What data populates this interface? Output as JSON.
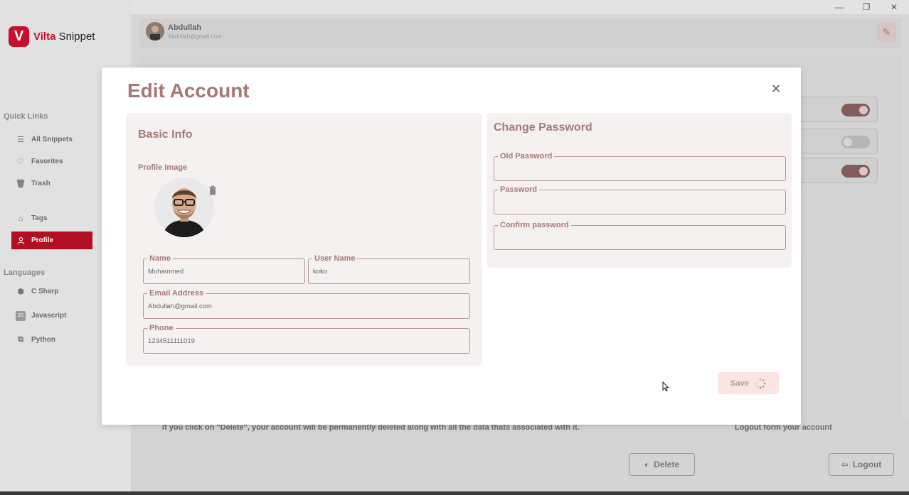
{
  "window": {
    "minimize": "—",
    "maximize": "❐",
    "close": "✕"
  },
  "brand": {
    "logo_letter": "V",
    "name_accent": "Vilta",
    "name_rest": " Snippet"
  },
  "sidebar": {
    "quick_links_heading": "Quick Links",
    "quick_links": [
      {
        "label": "All Snippets",
        "icon": "list-icon"
      },
      {
        "label": "Favorites",
        "icon": "heart-icon"
      },
      {
        "label": "Trash",
        "icon": "trash-icon"
      }
    ],
    "tags": {
      "label": "Tags",
      "icon": "tag-icon"
    },
    "profile": {
      "label": "Profile",
      "icon": "user-icon"
    },
    "languages_heading": "Languages",
    "languages": [
      {
        "label": "C Sharp",
        "icon": "csharp-icon"
      },
      {
        "label": "Javascript",
        "icon": "js-icon"
      },
      {
        "label": "Python",
        "icon": "python-icon"
      }
    ]
  },
  "header": {
    "user_name": "Abdullah",
    "user_email": "Abdullah@gmail.com"
  },
  "background": {
    "toggles": [
      "on",
      "off",
      "on"
    ],
    "delete_note": "If you click on \"Delete\", your account will be permanently deleted along with all the data thats associated with it.",
    "logout_note": "Logout form your account",
    "delete_label": "Delete",
    "logout_label": "Logout"
  },
  "modal": {
    "title": "Edit Account",
    "basic_info": {
      "title": "Basic Info",
      "profile_image_label": "Profile Image",
      "name_label": "Name",
      "name_value": "Mohammed",
      "username_label": "User Name",
      "username_value": "koko",
      "email_label": "Email Address",
      "email_value": "Abdullah@gmail.com",
      "phone_label": "Phone",
      "phone_value": "1234511111019"
    },
    "change_password": {
      "title": "Change Password",
      "old_label": "Old Password",
      "old_value": "",
      "password_label": "Password",
      "password_value": "",
      "confirm_label": "Confirm password",
      "confirm_value": ""
    },
    "save_label": "Save"
  },
  "colors": {
    "accent": "#c8102e",
    "modal_title": "#a57878",
    "save_bg": "#fbe5e2"
  }
}
